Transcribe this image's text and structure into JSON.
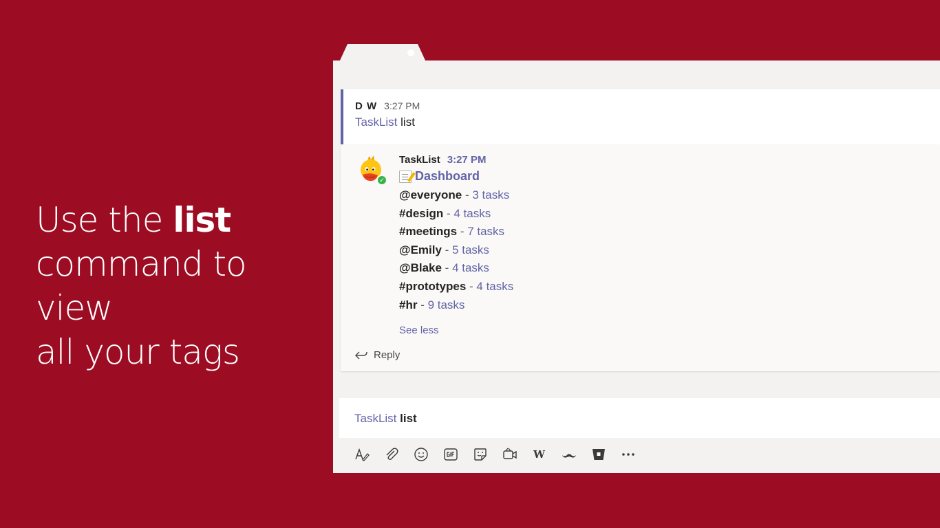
{
  "caption": {
    "line1_prefix": "Use the ",
    "line1_bold": "list",
    "line2": "command to view",
    "line3": "all your tags"
  },
  "user_message": {
    "sender": "D W",
    "time": "3:27 PM",
    "mention": "TaskList",
    "text": "list"
  },
  "bot_message": {
    "avatar": "duck-avatar",
    "name": "TaskList",
    "time": "3:27 PM",
    "dashboard_label": "Dashboard",
    "tags": [
      {
        "name": "@everyone",
        "count": "3 tasks"
      },
      {
        "name": "#design",
        "count": "4 tasks"
      },
      {
        "name": "#meetings",
        "count": "7 tasks"
      },
      {
        "name": "@Emily",
        "count": "5 tasks"
      },
      {
        "name": "@Blake",
        "count": "4 tasks"
      },
      {
        "name": "#prototypes",
        "count": "4 tasks"
      },
      {
        "name": "#hr",
        "count": "9 tasks"
      }
    ],
    "separator": " - ",
    "see_less": "See less",
    "reply": "Reply"
  },
  "compose": {
    "mention": "TaskList",
    "command": "list"
  },
  "toolbar": {
    "items": [
      "format-icon",
      "attach-icon",
      "emoji-icon",
      "gif-icon",
      "sticker-icon",
      "meet-icon",
      "wikipedia-icon",
      "mustache-icon",
      "bitbucket-icon",
      "more-icon"
    ],
    "wiki_glyph": "W"
  },
  "colors": {
    "background": "#9c0c23",
    "accent": "#6264a7",
    "window": "#f3f2f1"
  }
}
